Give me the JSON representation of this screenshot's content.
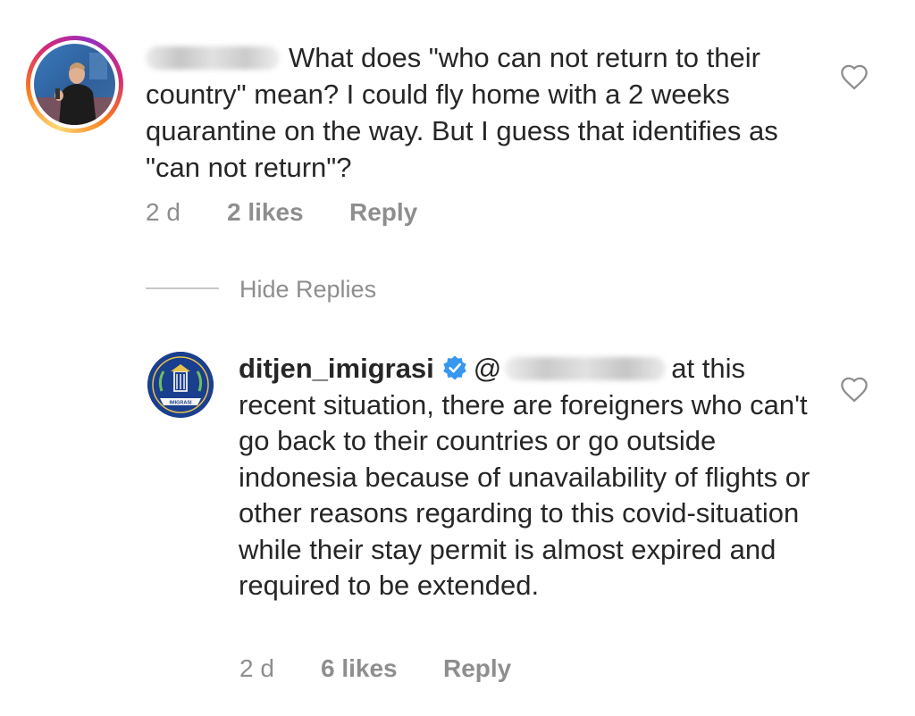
{
  "comment": {
    "text": "What does \"who can not return to their country\" mean? I could fly home with a 2 weeks quarantine on the way. But I guess that identifies as \"can not return\"?",
    "time": "2 d",
    "likes": "2 likes",
    "reply_label": "Reply"
  },
  "hide_replies_label": "Hide Replies",
  "reply": {
    "username": "ditjen_imigrasi",
    "text_after_mention": "at this recent situation, there are foreigners who can't go back to their countries or go outside indonesia because of unavailability of flights or other reasons regarding to this covid-situation while their stay permit is almost expired and required to be extended.",
    "mention_prefix": "@",
    "time": "2 d",
    "likes": "6 likes",
    "reply_label": "Reply",
    "logo_text": "IMIGRASI"
  },
  "colors": {
    "text": "#262626",
    "meta": "#8e8e8e",
    "verified": "#3897f0",
    "logo_blue": "#1a3f8f"
  },
  "icons": [
    "heart-icon",
    "verified-badge-icon"
  ]
}
